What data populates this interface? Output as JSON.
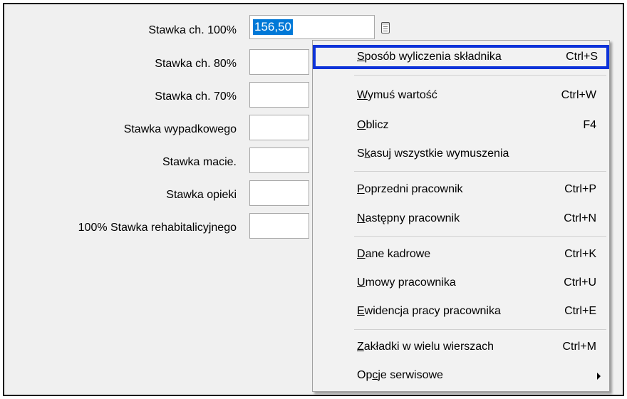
{
  "form": {
    "fields": [
      {
        "label": "Stawka ch. 100%",
        "value": "156,50"
      },
      {
        "label": "Stawka ch. 80%",
        "value": ""
      },
      {
        "label": "Stawka ch. 70%",
        "value": ""
      },
      {
        "label": "Stawka wypadkowego",
        "value": ""
      },
      {
        "label": "Stawka macie.",
        "value": ""
      },
      {
        "label": "Stawka opieki",
        "value": ""
      },
      {
        "label": "100% Stawka rehabitalicyjnego",
        "value": ""
      }
    ],
    "calc_icon": "calculator-icon"
  },
  "context_menu": {
    "items": [
      {
        "pre": "",
        "acc": "S",
        "post": "posób wyliczenia składnika",
        "shortcut": "Ctrl+S"
      },
      {
        "pre": "",
        "acc": "W",
        "post": "ymuś wartość",
        "shortcut": "Ctrl+W"
      },
      {
        "pre": "",
        "acc": "O",
        "post": "blicz",
        "shortcut": "F4"
      },
      {
        "pre": "S",
        "acc": "k",
        "post": "asuj wszystkie wymuszenia",
        "shortcut": ""
      },
      {
        "pre": "",
        "acc": "P",
        "post": "oprzedni pracownik",
        "shortcut": "Ctrl+P"
      },
      {
        "pre": "",
        "acc": "N",
        "post": "astępny pracownik",
        "shortcut": "Ctrl+N"
      },
      {
        "pre": "",
        "acc": "D",
        "post": "ane kadrowe",
        "shortcut": "Ctrl+K"
      },
      {
        "pre": "",
        "acc": "U",
        "post": "mowy pracownika",
        "shortcut": "Ctrl+U"
      },
      {
        "pre": "",
        "acc": "E",
        "post": "widencja pracy pracownika",
        "shortcut": "Ctrl+E"
      },
      {
        "pre": "",
        "acc": "Z",
        "post": "akładki w wielu wierszach",
        "shortcut": "Ctrl+M"
      },
      {
        "pre": "Op",
        "acc": "c",
        "post": "je serwisowe",
        "shortcut": ""
      }
    ],
    "submenu_arrow_icon": "chevron-right-icon"
  },
  "colors": {
    "selection": "#0078d7",
    "highlight_outline": "#0d33d9",
    "menu_background": "#f2f2f2",
    "panel_background": "#f0f0f0"
  }
}
